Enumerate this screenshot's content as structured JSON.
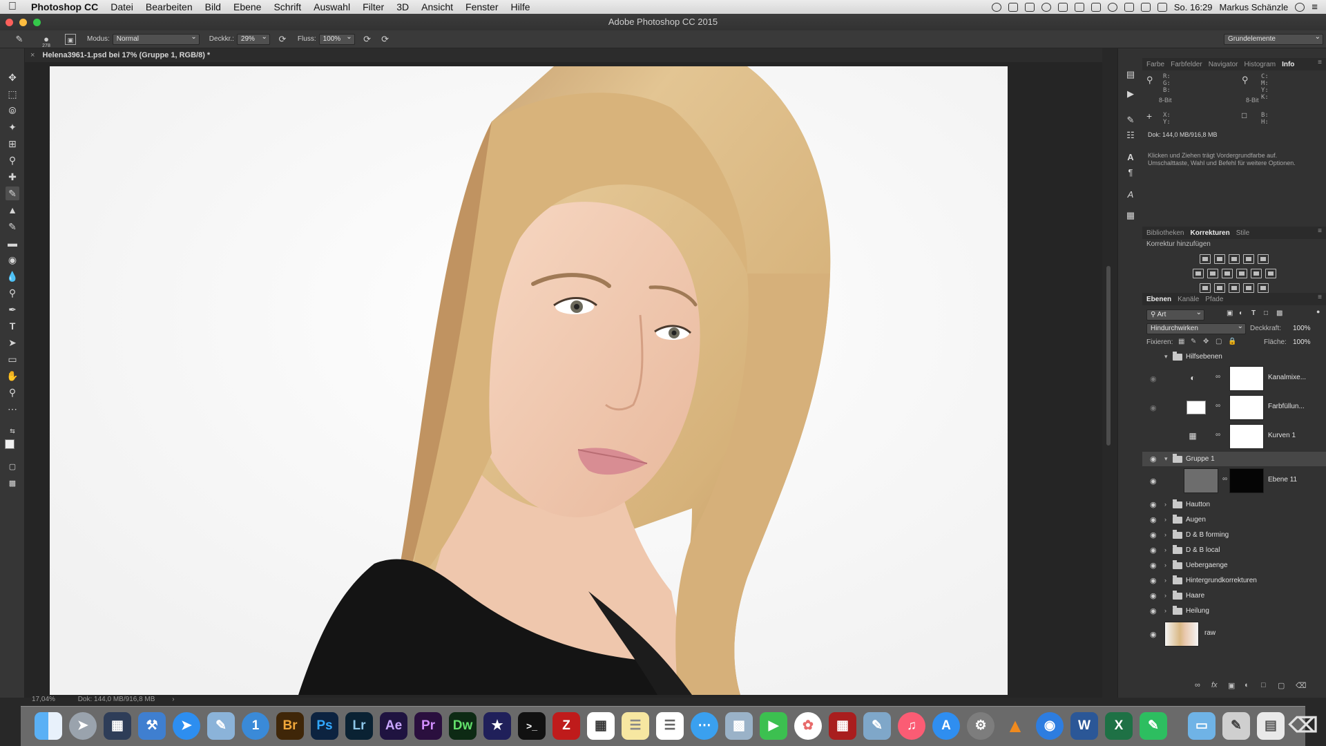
{
  "menubar": {
    "apple": "",
    "app_name": "Photoshop CC",
    "items": [
      "Datei",
      "Bearbeiten",
      "Bild",
      "Ebene",
      "Schrift",
      "Auswahl",
      "Filter",
      "3D",
      "Ansicht",
      "Fenster",
      "Hilfe"
    ],
    "clock": "So. 16:29",
    "user": "Markus Schänzle"
  },
  "window": {
    "title": "Adobe Photoshop CC 2015"
  },
  "options": {
    "brush_size": "278",
    "modus_label": "Modus:",
    "modus_value": "Normal",
    "deckkr_label": "Deckkr.:",
    "deckkr_value": "29%",
    "fluss_label": "Fluss:",
    "fluss_value": "100%",
    "workspace": "Grundelemente"
  },
  "document": {
    "tab_title": "Helena3961-1.psd bei 17% (Gruppe 1, RGB/8) *",
    "status_zoom": "17,04%",
    "status_doc": "Dok: 144,0 MB/916,8 MB"
  },
  "info_panel": {
    "tabs": [
      "Farbe",
      "Farbfelder",
      "Navigator",
      "Histogram",
      "Info"
    ],
    "active_tab": "Info",
    "rgb_labels": "R:\nG:\nB:",
    "bit_left": "8-Bit",
    "cmyk_labels": "C:\nM:\nY:\nK:",
    "bit_right": "8-Bit",
    "xy_labels": "X:\nY:",
    "bh_labels": "B:\nH:",
    "doc": "Dok: 144,0 MB/916,8 MB",
    "hint": "Klicken und Ziehen trägt Vordergrundfarbe auf. Umschalttaste, Wahl und Befehl für weitere Optionen."
  },
  "corrections_panel": {
    "tabs": [
      "Bibliotheken",
      "Korrekturen",
      "Stile"
    ],
    "active_tab": "Korrekturen",
    "heading": "Korrektur hinzufügen"
  },
  "layers_panel": {
    "tabs": [
      "Ebenen",
      "Kanäle",
      "Pfade"
    ],
    "active_tab": "Ebenen",
    "filter_label": "Art",
    "blend_mode": "Hindurchwirken",
    "opacity_label": "Deckkraft:",
    "opacity_value": "100%",
    "lock_label": "Fixieren:",
    "fill_label": "Fläche:",
    "fill_value": "100%",
    "layers": [
      {
        "name": "Hilfsebenen",
        "type": "group",
        "expanded": true,
        "visible": false
      },
      {
        "name": "Kanalmixe...",
        "type": "adjustment",
        "visible": false
      },
      {
        "name": "Farbfüllun...",
        "type": "adjustment",
        "visible": false
      },
      {
        "name": "Kurven 1",
        "type": "adjustment",
        "visible": false
      },
      {
        "name": "Gruppe 1",
        "type": "group",
        "expanded": true,
        "visible": true,
        "selected": true
      },
      {
        "name": "Ebene 11",
        "type": "pixel",
        "visible": true
      },
      {
        "name": "Hautton",
        "type": "group",
        "visible": true
      },
      {
        "name": "Augen",
        "type": "group",
        "visible": true
      },
      {
        "name": "D & B forming",
        "type": "group",
        "visible": true
      },
      {
        "name": "D & B local",
        "type": "group",
        "visible": true
      },
      {
        "name": "Uebergaenge",
        "type": "group",
        "visible": true
      },
      {
        "name": "Hintergrundkorrekturen",
        "type": "group",
        "visible": true
      },
      {
        "name": "Haare",
        "type": "group",
        "visible": true
      },
      {
        "name": "Heilung",
        "type": "group",
        "visible": true
      },
      {
        "name": "raw",
        "type": "pixel",
        "visible": true
      }
    ]
  },
  "dock": {
    "apps": [
      "Finder",
      "Launchpad",
      "Mission Control",
      "Xcode",
      "Safari",
      "Vorschau",
      "1Password",
      "Br",
      "Ps",
      "Lr",
      "Ae",
      "Pr",
      "Dw",
      "iMovie",
      "Terminal",
      "FileZilla",
      "Kalender",
      "Notizen",
      "Erinnerungen",
      "Nachrichten",
      "Bilderfassung",
      "FaceTime",
      "Fotos",
      "Photo Booth",
      "Vorschau 2",
      "iTunes",
      "App Store",
      "Systemeinstellungen",
      "VLC",
      "Chrome",
      "Word",
      "Excel",
      "Evernote",
      "Ordner",
      "Brushes",
      "Dokumente",
      "Papierkorb"
    ]
  }
}
